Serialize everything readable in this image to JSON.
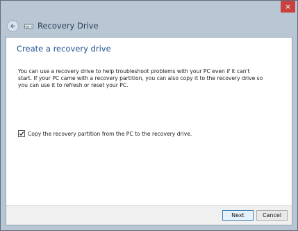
{
  "window": {
    "title": "Recovery Drive",
    "close_glyph": "×"
  },
  "icons": {
    "back": "back-arrow-icon",
    "drive": "recovery-drive-icon",
    "close": "close-icon"
  },
  "main": {
    "heading": "Create a recovery drive",
    "description": "You can use a recovery drive to help troubleshoot problems with your PC even if it can't start. If your PC came with a recovery partition, you can also copy it to the recovery drive so you can use it to refresh or reset your PC.",
    "checkbox": {
      "label": "Copy the recovery partition from the PC to the recovery drive.",
      "checked": true
    }
  },
  "footer": {
    "next_label": "Next",
    "cancel_label": "Cancel"
  },
  "colors": {
    "accent": "#1f4e91",
    "chrome": "#b9c7d5",
    "close": "#c8413f"
  }
}
